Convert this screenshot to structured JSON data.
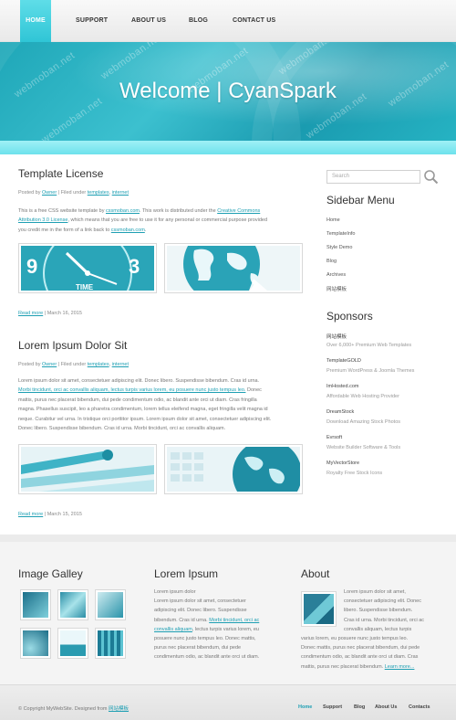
{
  "nav": {
    "items": [
      {
        "label": "HOME",
        "active": true
      },
      {
        "label": "SUPPORT"
      },
      {
        "label": "ABOUT US"
      },
      {
        "label": "BLOG"
      },
      {
        "label": "CONTACT US"
      }
    ]
  },
  "banner": {
    "title": "Welcome | CyanSpark"
  },
  "watermark": "webmoban.net",
  "posts": [
    {
      "title": "Template License",
      "meta_prefix": "Posted by ",
      "author": "Owner",
      "meta_mid": " | Filed under ",
      "tag1": "templates",
      "tag_sep": ", ",
      "tag2": "internet",
      "text1": "This is a free CSS website template by ",
      "link1": "cssmoban.com",
      "text2": ". This work is distributed under the ",
      "link2a": "Creative Commons",
      "link2b": "Attribution 3.0 License",
      "text3": ", which means that you are free to use it for any personal or commercial purpose provided",
      "text4": "you credit me in the form of a link back to ",
      "link3": "cssmoban.com",
      "text5": ".",
      "read_more": "Read more",
      "date": " | March 16, 2015"
    },
    {
      "title": "Lorem Ipsum Dolor Sit",
      "meta_prefix": "Posted by ",
      "author": "Owner",
      "meta_mid": " | Filed under ",
      "tag1": "templates",
      "tag_sep": ", ",
      "tag2": "internet",
      "line1": "Lorem ipsum dolor sit amet, consectetuer adipiscing elit. Donec libero. Suspendisse bibendum. Cras id urna.",
      "link_a": "Morbi tincidunt, orci ac convallis aliquam, lectus turpis varius lorem, eu posuere nunc justo tempus leo.",
      "line2b": " Donec",
      "line3": "mattis, purus nec placerat bibendum, dui pede condimentum odio, ac blandit ante orci ut diam. Cras fringilla",
      "line4": "magna. Phasellus suscipit, leo a pharetra condimentum, lorem tellus eleifend magna, eget fringilla velit magna id",
      "line5": "neque. Curabitur vel urna. In tristique orci porttitor ipsum. Lorem ipsum dolor sit amet, consectetuer adipiscing elit.",
      "line6": "Donec libero. Suspendisse bibendum. Cras id urna. Morbi tincidunt, orci ac convallis aliquam.",
      "read_more": "Read more",
      "date": " | March 15, 2015"
    }
  ],
  "sidebar": {
    "search_placeholder": "Search",
    "menu_title": "Sidebar Menu",
    "menu": [
      "Home",
      "TemplateInfo",
      "Style Demo",
      "Blog",
      "Archives",
      "网站模板"
    ],
    "sponsors_title": "Sponsors",
    "sponsors": [
      {
        "name": "网站模板",
        "desc": "Over 6,000+ Premium Web Templates"
      },
      {
        "name": "TemplateGOLD",
        "desc": "Premium WordPress & Joomla Themes"
      },
      {
        "name": "ImHosted.com",
        "desc": "Affordable Web Hosting Provider"
      },
      {
        "name": "DreamStock",
        "desc": "Download Amazing Stock Photos"
      },
      {
        "name": "Evrsoft",
        "desc": "Website Builder Software & Tools"
      },
      {
        "name": "MyVectorStore",
        "desc": "Royalty Free Stock Icons"
      }
    ]
  },
  "footer": {
    "gallery_title": "Image Galley",
    "lorem_title": "Lorem Ipsum",
    "lorem_lines": [
      "Lorem ipsum dolor",
      "Lorem ipsum dolor sit amet, consectetuer",
      "adipiscing elit. Donec libero. Suspendisse",
      "bibendum. Cras id urna. "
    ],
    "lorem_link_a": "Morbi tincidunt, orci ac",
    "lorem_link_b": "convallis aliquam",
    "lorem_rest": [
      ", lectus turpis varius lorem, eu",
      "posuere nunc justo tempus leo. Donec mattis,",
      "purus nec placerat bibendum, dui pede",
      "condimentum odio, ac blandit ante orci ut diam."
    ],
    "about_title": "About",
    "about_lines_side": [
      "Lorem ipsum dolor sit amet,",
      "consectetuer adipiscing elit. Donec",
      "libero. Suspendisse bibendum.",
      "Cras id urna. Morbi tincidunt, orci ac",
      "convallis aliquam, lectus turpis"
    ],
    "about_lines_full": [
      "varius lorem, eu posuere nunc justo tempus leo.",
      "Donec mattis, purus nec placerat bibendum, dui pede",
      "condimentum odio, ac blandit ante orci ut diam. Cras",
      "mattis, purus nec placerat bibendum. "
    ],
    "learn_more": "Learn more..."
  },
  "bottom": {
    "copyright_prefix": "© Copyright MyWebSite. Designed from ",
    "copyright_link": "网站模板",
    "links": [
      "Home",
      "Support",
      "Blog",
      "About Us",
      "Contacts"
    ]
  },
  "colors": {
    "accent": "#1e9fb3",
    "nav_active": "#3fcfdc",
    "banner": "#24aebf"
  }
}
